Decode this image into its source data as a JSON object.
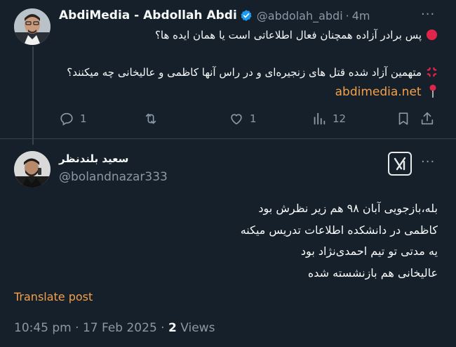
{
  "original_tweet": {
    "author_name": "AbdiMedia - Abdollah Abdi",
    "handle": "@abdolah_abdi",
    "separator": "·",
    "time": "4m",
    "more_label": "···",
    "line1": "پس برادر آزاده همچنان فعال اطلاعاتی است یا همان ایده ها؟",
    "line2": "متهمین آزاد شده قتل های زنجیره‌ای و در راس آنها کاظمی و عالیخانی چه میکنند؟",
    "link": "abdimedia.net",
    "replies": "1",
    "likes": "1",
    "views": "12",
    "icons": {
      "reply": "reply-icon",
      "retweet": "retweet-icon",
      "like": "heart-icon",
      "views": "views-icon",
      "bookmark": "bookmark-icon",
      "share": "share-icon",
      "verified": "verified-badge-icon",
      "red_circle": "red-circle-emoji",
      "anger": "anger-symbol-emoji",
      "pin": "round-pushpin-emoji"
    }
  },
  "reply_tweet": {
    "author_name": "سعید بلندنظر",
    "handle": "@bolandnazar333",
    "more_label": "···",
    "lines": [
      "بله،بازجویی آبان ۹۸ هم زیر نظرش بود",
      "کاظمی در دانشکده اطلاعات تدریس میکنه",
      "یه مدتی تو تیم احمدی‌نژاد بود",
      "عالیخانی هم بازنشسته شده"
    ],
    "translate_label": "Translate post",
    "timestamp": "10:45 pm · 17 Feb 2025 · ",
    "views_count": "2",
    "views_label": " Views",
    "grok_icon": "grok-icon"
  },
  "colors": {
    "background": "#15202b",
    "text": "#f7f9f9",
    "muted": "#8b98a5",
    "accent": "#f4a04a",
    "verified": "#1d9bf0",
    "divider": "#38444d"
  }
}
